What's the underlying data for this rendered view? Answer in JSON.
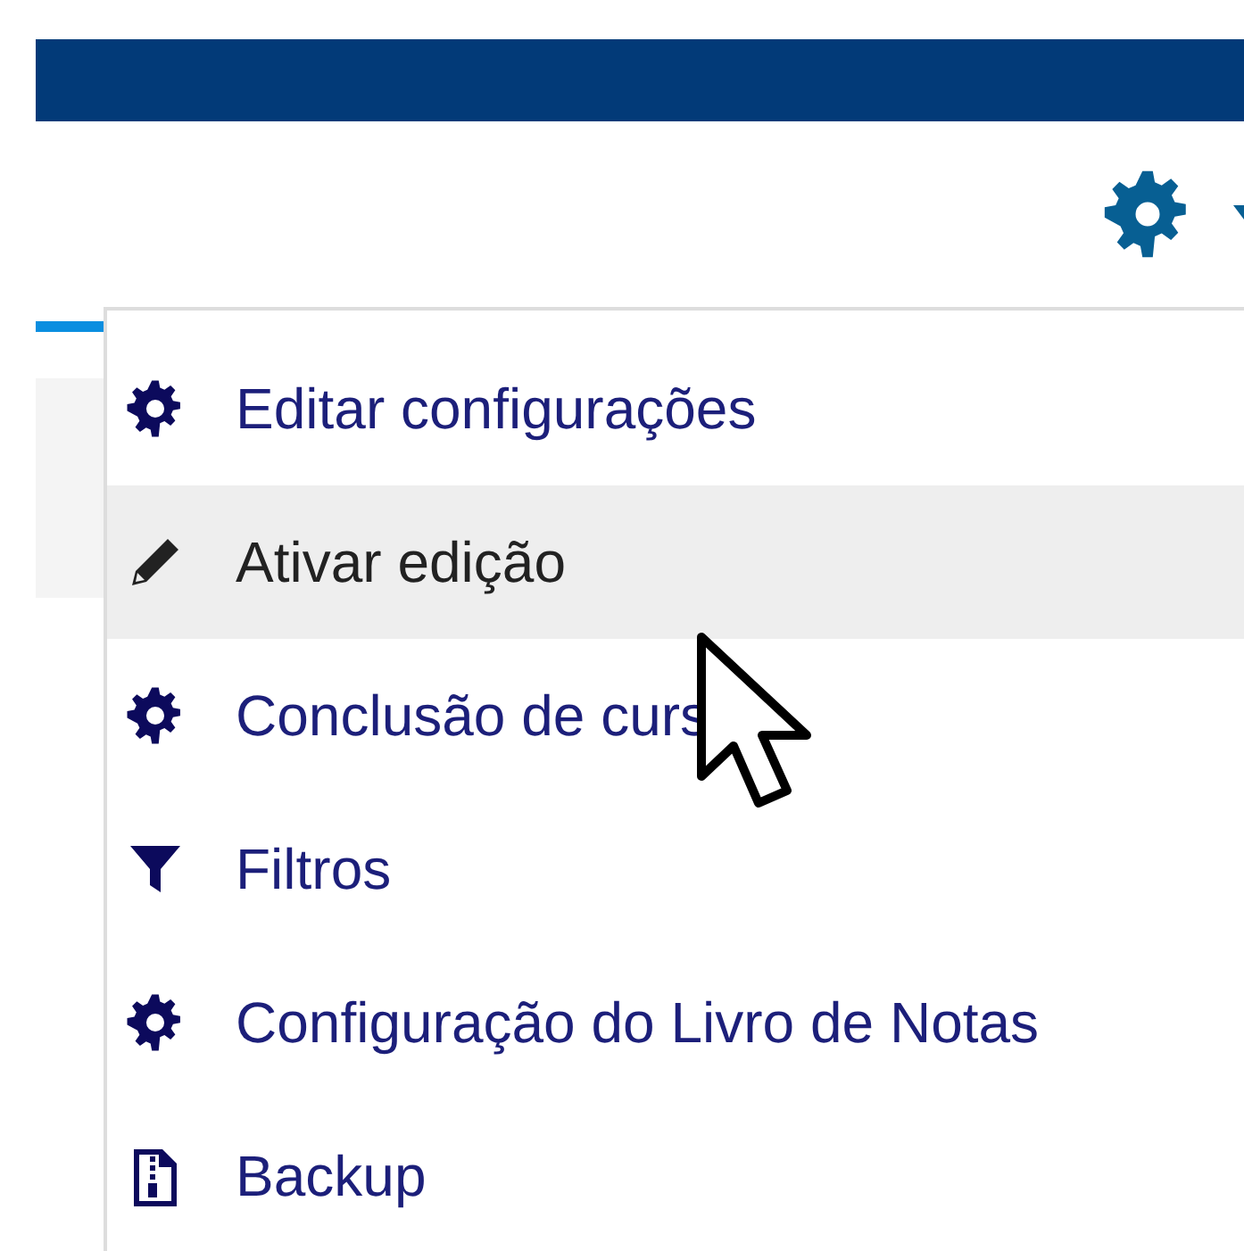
{
  "menu": {
    "items": [
      {
        "kind": "gear",
        "label": "Editar configurações",
        "selected": false
      },
      {
        "kind": "pencil",
        "label": "Ativar edição",
        "selected": true
      },
      {
        "kind": "gear",
        "label": "Conclusão de curs",
        "selected": false,
        "pointer": true
      },
      {
        "kind": "filter",
        "label": "Filtros",
        "selected": false
      },
      {
        "kind": "gear",
        "label": "Configuração do Livro de Notas",
        "selected": false
      },
      {
        "kind": "archive",
        "label": "Backup",
        "selected": false
      }
    ]
  }
}
